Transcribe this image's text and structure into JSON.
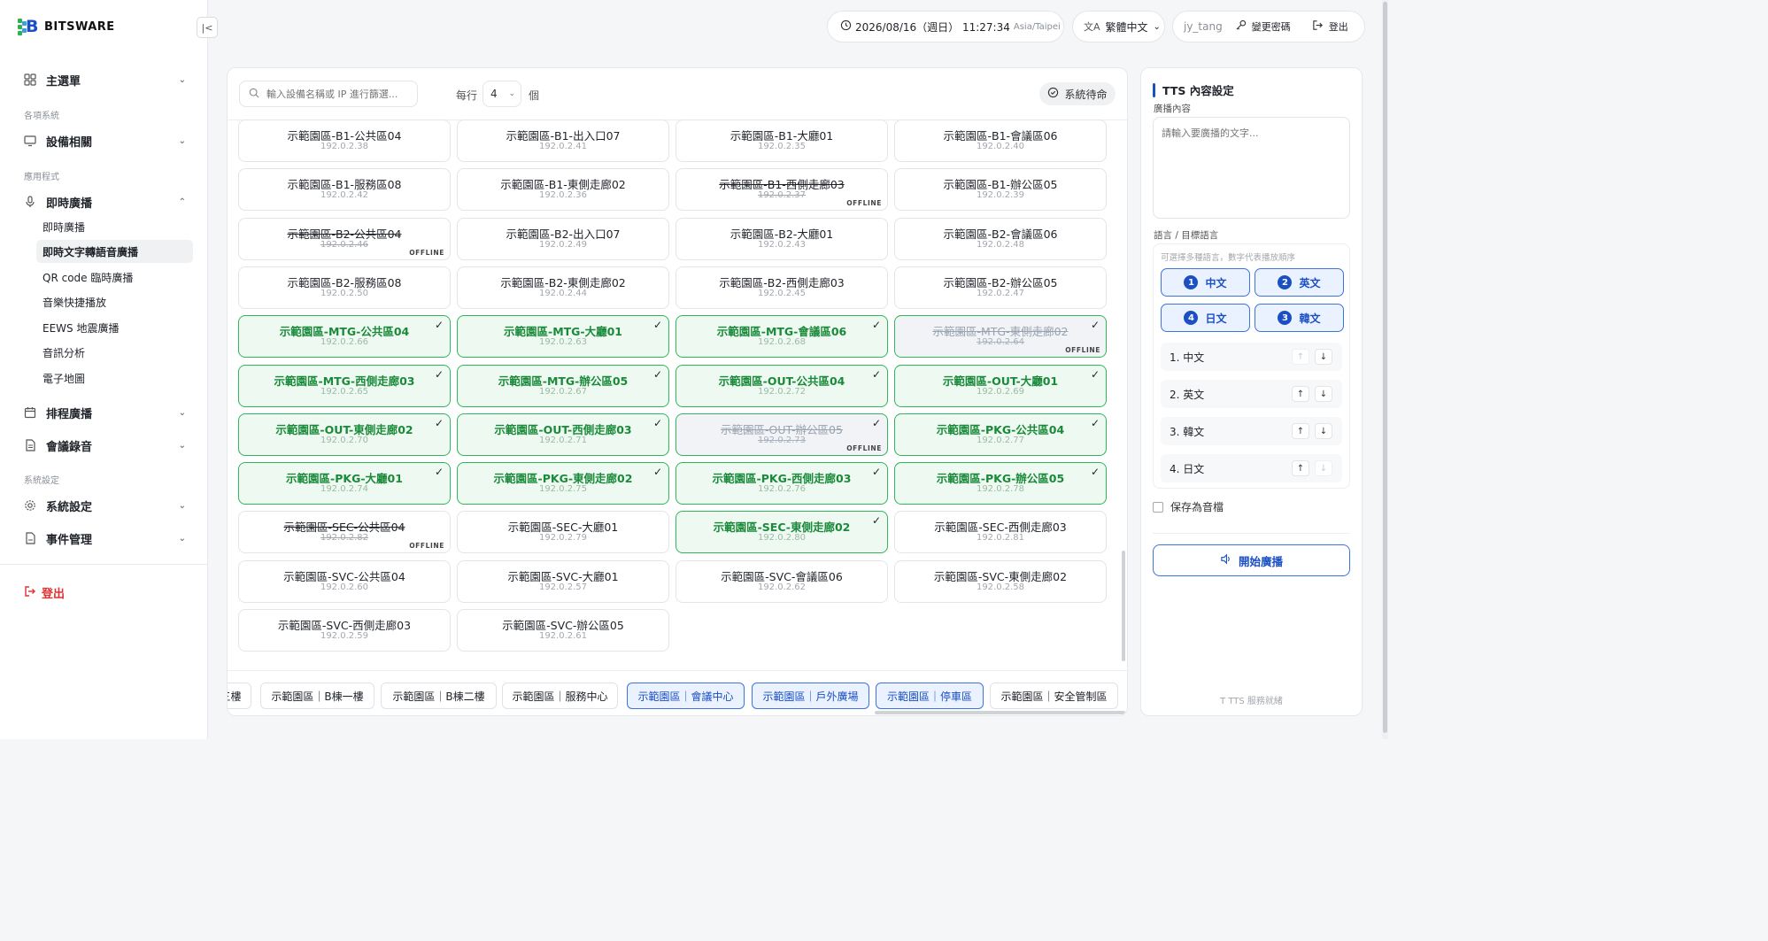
{
  "brand": {
    "name": "BITSWARE"
  },
  "sidebar": {
    "main_menu": "主選單",
    "section_systems": "各項系統",
    "device": "設備相關",
    "section_apps": "應用程式",
    "broadcast": "即時廣播",
    "sub_items": [
      "即時廣播",
      "即時文字轉語音廣播",
      "QR code 臨時廣播",
      "音樂快捷播放",
      "EEWS 地震廣播",
      "音訊分析",
      "電子地圖"
    ],
    "active_sub": "即時文字轉語音廣播",
    "schedule": "排程廣播",
    "meeting": "會議錄音",
    "section_settings": "系統設定",
    "settings": "系統設定",
    "events": "事件管理",
    "logout": "登出"
  },
  "topbar": {
    "datetime": "2026/08/16（週日） 11:27:34",
    "timezone": "Asia/Taipei",
    "language": "繁體中文",
    "username": "jy_tang",
    "change_password": "變更密碼",
    "logout": "登出"
  },
  "toolbar": {
    "search_placeholder": "輸入設備名稱或 IP 進行篩選...",
    "per_row_label": "每行",
    "per_row_value": "4",
    "per_row_unit": "個",
    "standby": "系統待命"
  },
  "devices": [
    {
      "name": "示範園區-B1-公共區04",
      "ip": "192.0.2.38",
      "selected": false,
      "offline": false
    },
    {
      "name": "示範園區-B1-出入口07",
      "ip": "192.0.2.41",
      "selected": false,
      "offline": false
    },
    {
      "name": "示範園區-B1-大廳01",
      "ip": "192.0.2.35",
      "selected": false,
      "offline": false
    },
    {
      "name": "示範園區-B1-會議區06",
      "ip": "192.0.2.40",
      "selected": false,
      "offline": false
    },
    {
      "name": "示範園區-B1-服務區08",
      "ip": "192.0.2.42",
      "selected": false,
      "offline": false
    },
    {
      "name": "示範園區-B1-東側走廊02",
      "ip": "192.0.2.36",
      "selected": false,
      "offline": false
    },
    {
      "name": "示範園區-B1-西側走廊03",
      "ip": "192.0.2.37",
      "selected": false,
      "offline": true
    },
    {
      "name": "示範園區-B1-辦公區05",
      "ip": "192.0.2.39",
      "selected": false,
      "offline": false
    },
    {
      "name": "示範園區-B2-公共區04",
      "ip": "192.0.2.46",
      "selected": false,
      "offline": true
    },
    {
      "name": "示範園區-B2-出入口07",
      "ip": "192.0.2.49",
      "selected": false,
      "offline": false
    },
    {
      "name": "示範園區-B2-大廳01",
      "ip": "192.0.2.43",
      "selected": false,
      "offline": false
    },
    {
      "name": "示範園區-B2-會議區06",
      "ip": "192.0.2.48",
      "selected": false,
      "offline": false
    },
    {
      "name": "示範園區-B2-服務區08",
      "ip": "192.0.2.50",
      "selected": false,
      "offline": false
    },
    {
      "name": "示範園區-B2-東側走廊02",
      "ip": "192.0.2.44",
      "selected": false,
      "offline": false
    },
    {
      "name": "示範園區-B2-西側走廊03",
      "ip": "192.0.2.45",
      "selected": false,
      "offline": false
    },
    {
      "name": "示範園區-B2-辦公區05",
      "ip": "192.0.2.47",
      "selected": false,
      "offline": false
    },
    {
      "name": "示範園區-MTG-公共區04",
      "ip": "192.0.2.66",
      "selected": true,
      "offline": false
    },
    {
      "name": "示範園區-MTG-大廳01",
      "ip": "192.0.2.63",
      "selected": true,
      "offline": false
    },
    {
      "name": "示範園區-MTG-會議區06",
      "ip": "192.0.2.68",
      "selected": true,
      "offline": false
    },
    {
      "name": "示範園區-MTG-東側走廊02",
      "ip": "192.0.2.64",
      "selected": true,
      "offline": true
    },
    {
      "name": "示範園區-MTG-西側走廊03",
      "ip": "192.0.2.65",
      "selected": true,
      "offline": false
    },
    {
      "name": "示範園區-MTG-辦公區05",
      "ip": "192.0.2.67",
      "selected": true,
      "offline": false
    },
    {
      "name": "示範園區-OUT-公共區04",
      "ip": "192.0.2.72",
      "selected": true,
      "offline": false
    },
    {
      "name": "示範園區-OUT-大廳01",
      "ip": "192.0.2.69",
      "selected": true,
      "offline": false
    },
    {
      "name": "示範園區-OUT-東側走廊02",
      "ip": "192.0.2.70",
      "selected": true,
      "offline": false
    },
    {
      "name": "示範園區-OUT-西側走廊03",
      "ip": "192.0.2.71",
      "selected": true,
      "offline": false
    },
    {
      "name": "示範園區-OUT-辦公區05",
      "ip": "192.0.2.73",
      "selected": true,
      "offline": true
    },
    {
      "name": "示範園區-PKG-公共區04",
      "ip": "192.0.2.77",
      "selected": true,
      "offline": false
    },
    {
      "name": "示範園區-PKG-大廳01",
      "ip": "192.0.2.74",
      "selected": true,
      "offline": false
    },
    {
      "name": "示範園區-PKG-東側走廊02",
      "ip": "192.0.2.75",
      "selected": true,
      "offline": false
    },
    {
      "name": "示範園區-PKG-西側走廊03",
      "ip": "192.0.2.76",
      "selected": true,
      "offline": false
    },
    {
      "name": "示範園區-PKG-辦公區05",
      "ip": "192.0.2.78",
      "selected": true,
      "offline": false
    },
    {
      "name": "示範園區-SEC-公共區04",
      "ip": "192.0.2.82",
      "selected": false,
      "offline": true
    },
    {
      "name": "示範園區-SEC-大廳01",
      "ip": "192.0.2.79",
      "selected": false,
      "offline": false
    },
    {
      "name": "示範園區-SEC-東側走廊02",
      "ip": "192.0.2.80",
      "selected": true,
      "offline": false
    },
    {
      "name": "示範園區-SEC-西側走廊03",
      "ip": "192.0.2.81",
      "selected": false,
      "offline": false
    },
    {
      "name": "示範園區-SVC-公共區04",
      "ip": "192.0.2.60",
      "selected": false,
      "offline": false
    },
    {
      "name": "示範園區-SVC-大廳01",
      "ip": "192.0.2.57",
      "selected": false,
      "offline": false
    },
    {
      "name": "示範園區-SVC-會議區06",
      "ip": "192.0.2.62",
      "selected": false,
      "offline": false
    },
    {
      "name": "示範園區-SVC-東側走廊02",
      "ip": "192.0.2.58",
      "selected": false,
      "offline": false
    },
    {
      "name": "示範園區-SVC-西側走廊03",
      "ip": "192.0.2.59",
      "selected": false,
      "offline": false
    },
    {
      "name": "示範園區-SVC-辦公區05",
      "ip": "192.0.2.61",
      "selected": false,
      "offline": false
    }
  ],
  "offline_label": "OFFLINE",
  "check_mark": "✓",
  "zones": [
    {
      "label": "三樓",
      "active": false
    },
    {
      "label": "示範園區｜B棟一樓",
      "active": false
    },
    {
      "label": "示範園區｜B棟二樓",
      "active": false
    },
    {
      "label": "示範園區｜服務中心",
      "active": false
    },
    {
      "label": "示範園區｜會議中心",
      "active": true
    },
    {
      "label": "示範園區｜戶外廣場",
      "active": true
    },
    {
      "label": "示範園區｜停車區",
      "active": true
    },
    {
      "label": "示範園區｜安全管制區",
      "active": false
    }
  ],
  "tts": {
    "title": "TTS 內容設定",
    "content_label": "廣播內容",
    "content_placeholder": "請輸入要廣播的文字...",
    "lang_label": "語言 / 目標語言",
    "lang_hint": "可選擇多種語言，數字代表播放順序",
    "lang_buttons": [
      {
        "num": "1",
        "label": "中文"
      },
      {
        "num": "2",
        "label": "英文"
      },
      {
        "num": "4",
        "label": "日文"
      },
      {
        "num": "3",
        "label": "韓文"
      }
    ],
    "order": [
      "1. 中文",
      "2. 英文",
      "3. 韓文",
      "4. 日文"
    ],
    "save_audio": "保存為音檔",
    "start": "開始廣播",
    "status": "TTS 服務就緒"
  }
}
